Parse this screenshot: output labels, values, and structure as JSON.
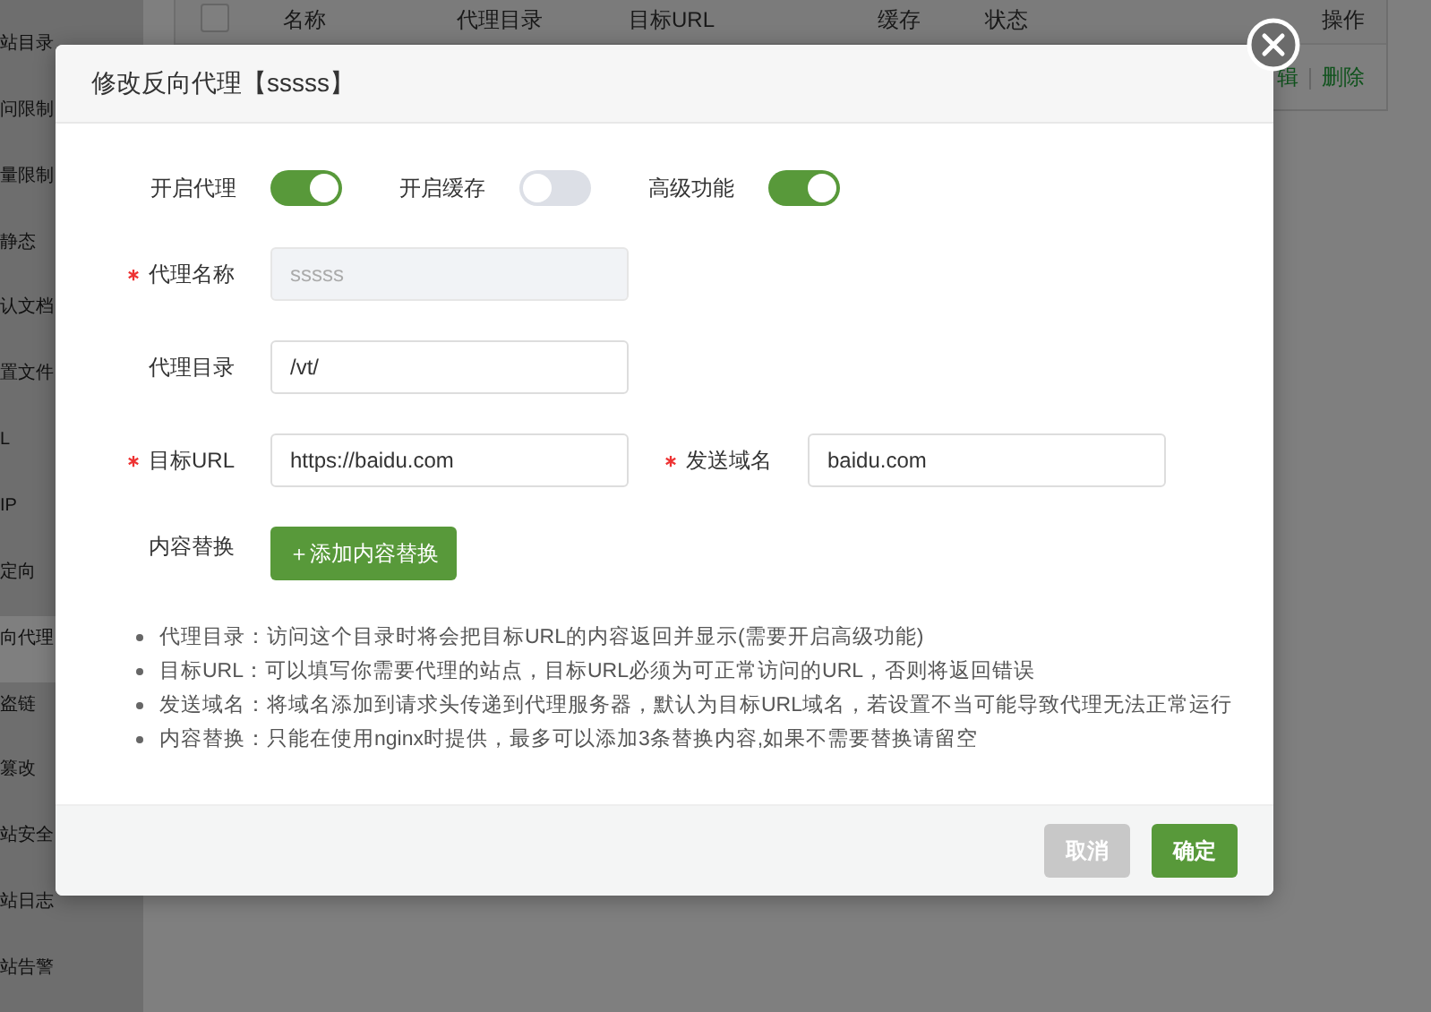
{
  "sidebar": {
    "items": [
      {
        "label": "站目录",
        "selected": false
      },
      {
        "label": "问限制",
        "selected": false
      },
      {
        "label": "量限制",
        "selected": false
      },
      {
        "label": "静态",
        "selected": false
      },
      {
        "label": "认文档",
        "selected": false
      },
      {
        "label": "置文件",
        "selected": false
      },
      {
        "label": "L",
        "selected": false
      },
      {
        "label": "IP",
        "selected": false
      },
      {
        "label": "定向",
        "selected": false
      },
      {
        "label": "向代理",
        "selected": true
      },
      {
        "label": "盗链",
        "selected": false
      },
      {
        "label": "篡改",
        "selected": false
      },
      {
        "label": "站安全",
        "selected": false
      },
      {
        "label": "站日志",
        "selected": false
      },
      {
        "label": "站告警",
        "selected": false
      }
    ]
  },
  "table": {
    "select_all": {
      "checked": false
    },
    "columns": [
      "名称",
      "代理目录",
      "目标URL",
      "缓存",
      "状态",
      "操作"
    ],
    "rows": [
      {
        "actions": [
          "辑",
          "删除"
        ]
      }
    ]
  },
  "dialog": {
    "title": "修改反向代理【sssss】",
    "toggles": [
      {
        "label": "开启代理",
        "on": true
      },
      {
        "label": "开启缓存",
        "on": false
      },
      {
        "label": "高级功能",
        "on": true
      }
    ],
    "form_rows": [
      {
        "fields": [
          {
            "kind": "input",
            "label": "代理名称",
            "required": true,
            "value": "sssss",
            "disabled": true
          }
        ]
      },
      {
        "fields": [
          {
            "kind": "input",
            "label": "代理目录",
            "required": false,
            "value": "/vt/",
            "disabled": false
          }
        ]
      },
      {
        "fields": [
          {
            "kind": "input",
            "label": "目标URL",
            "required": true,
            "value": "https://baidu.com",
            "disabled": false
          },
          {
            "kind": "input",
            "label": "发送域名",
            "required": true,
            "value": "baidu.com",
            "disabled": false
          }
        ]
      },
      {
        "fields": [
          {
            "kind": "button",
            "label": "内容替换",
            "required": false,
            "value": "＋添加内容替换"
          }
        ]
      }
    ],
    "notes": [
      "代理目录：访问这个目录时将会把目标URL的内容返回并显示(需要开启高级功能)",
      "目标URL：可以填写你需要代理的站点，目标URL必须为可正常访问的URL，否则将返回错误",
      "发送域名：将域名添加到请求头传递到代理服务器，默认为目标URL域名，若设置不当可能导致代理无法正常运行",
      "内容替换：只能在使用nginx时提供，最多可以添加3条替换内容,如果不需要替换请留空"
    ],
    "buttons": [
      {
        "label": "取消",
        "kind": "cancel"
      },
      {
        "label": "确定",
        "kind": "confirm"
      }
    ]
  }
}
